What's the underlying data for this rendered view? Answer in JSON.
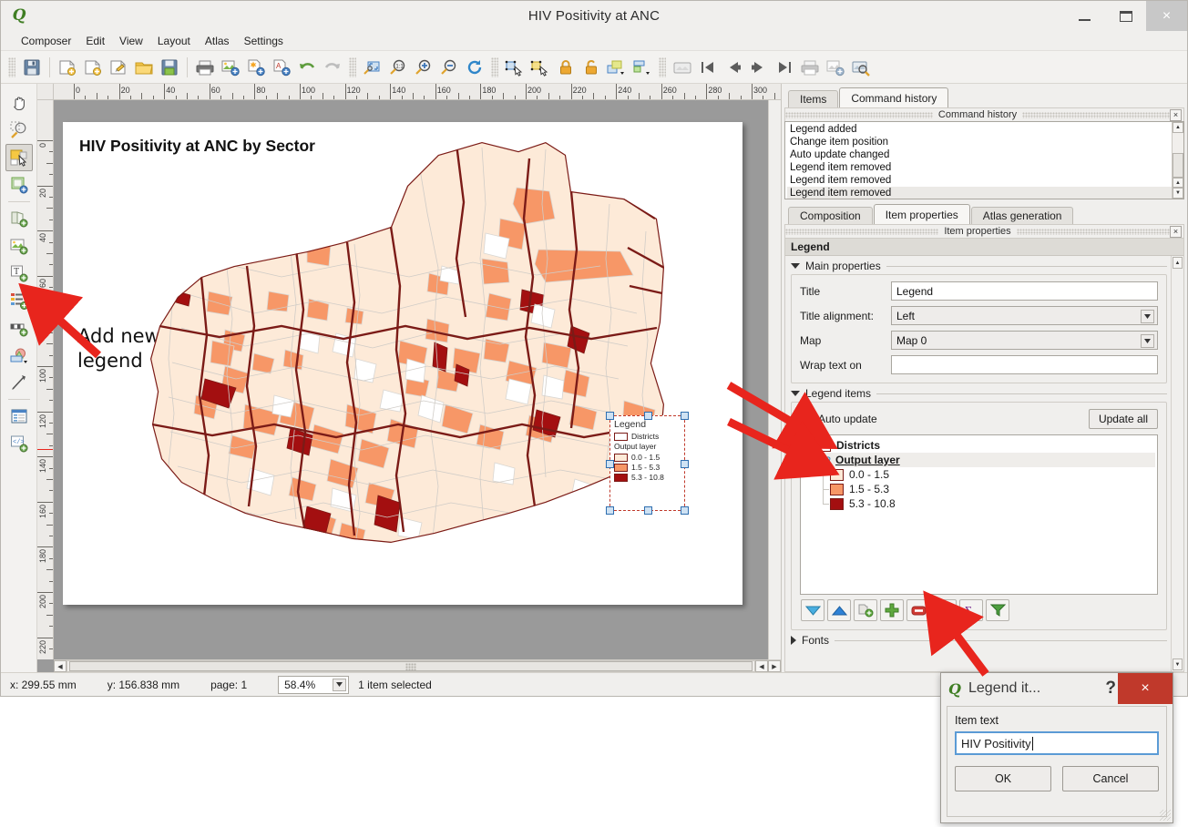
{
  "window": {
    "title": "HIV Positivity at ANC",
    "app_icon": "qgis-icon",
    "minimize_label": "minimize-icon",
    "maximize_label": "maximize-icon",
    "close_label": "×"
  },
  "menubar": {
    "items": [
      "Composer",
      "Edit",
      "View",
      "Layout",
      "Atlas",
      "Settings"
    ]
  },
  "toolbar": {
    "groups": [
      {
        "icons": [
          "save-icon"
        ]
      },
      {
        "icons": [
          "new-composition-icon",
          "duplicate-composition-icon",
          "composer-manager-icon",
          "open-template-icon",
          "save-template-icon"
        ]
      },
      {
        "icons": [
          "print-icon",
          "export-image-icon",
          "export-svg-icon",
          "export-pdf-icon",
          "undo-icon",
          "redo-icon"
        ]
      },
      {
        "icons": [
          "zoom-full-icon",
          "zoom-actual-icon",
          "zoom-in-icon",
          "zoom-out-icon",
          "refresh-icon"
        ]
      },
      {
        "icons": [
          "select-move-item-icon",
          "move-content-icon",
          "lock-items-icon",
          "unlock-items-icon",
          "raise-items-icon",
          "align-items-icon"
        ]
      },
      {
        "icons": [
          "atlas-settings-icon",
          "atlas-first-icon",
          "atlas-prev-icon",
          "atlas-next-icon",
          "atlas-last-icon",
          "atlas-print-icon",
          "atlas-export-image-icon",
          "atlas-preview-icon"
        ]
      }
    ]
  },
  "left_toolbar": {
    "items": [
      {
        "name": "pan-layout-tool",
        "icon": "hand-icon",
        "active": false
      },
      {
        "name": "zoom-tool",
        "icon": "magnifier-icon",
        "active": false
      },
      {
        "name": "select-move-item-tool",
        "icon": "select-arrow-icon",
        "active": true
      },
      {
        "name": "move-item-content-tool",
        "icon": "move-content-icon",
        "active": false
      },
      {
        "name": "add-new-map-tool",
        "icon": "add-map-icon",
        "active": false
      },
      {
        "name": "add-image-tool",
        "icon": "add-image-icon",
        "active": false
      },
      {
        "name": "add-label-tool",
        "icon": "add-label-icon",
        "active": false
      },
      {
        "name": "add-legend-tool",
        "icon": "add-legend-icon",
        "active": false
      },
      {
        "name": "add-scalebar-tool",
        "icon": "add-scalebar-icon",
        "active": false
      },
      {
        "name": "add-shape-tool",
        "icon": "add-shape-icon",
        "active": false
      },
      {
        "name": "add-arrow-tool",
        "icon": "add-arrow-icon",
        "active": false
      },
      {
        "name": "add-attribute-table-tool",
        "icon": "add-table-icon",
        "active": false
      },
      {
        "name": "add-html-frame-tool",
        "icon": "add-html-icon",
        "active": false
      }
    ]
  },
  "rulers": {
    "horizontal_labels": [
      "0",
      "20",
      "40",
      "60",
      "80",
      "100",
      "120",
      "140",
      "160",
      "180",
      "200",
      "220",
      "240",
      "260",
      "280",
      "300"
    ],
    "vertical_labels": [
      "0",
      "20",
      "40",
      "60",
      "80",
      "100",
      "120",
      "140",
      "160",
      "180",
      "200",
      "220"
    ],
    "unit": "mm"
  },
  "composition": {
    "map_title": "HIV Positivity at ANC by Sector",
    "annotation_line1": "Add new",
    "annotation_line2": "legend",
    "legend_item": {
      "title": "Legend",
      "districts_label": "Districts",
      "output_layer_label": "Output layer",
      "classes": [
        {
          "label": "0.0 - 1.5",
          "color": "#fdead8"
        },
        {
          "label": "1.5 - 5.3",
          "color": "#f79767"
        },
        {
          "label": "5.3 - 10.8",
          "color": "#a30f10"
        }
      ]
    }
  },
  "right_dock": {
    "top_tabs": [
      {
        "label": "Items",
        "selected": false
      },
      {
        "label": "Command history",
        "selected": true
      }
    ],
    "command_history": {
      "panel_title": "Command history",
      "close_label": "×",
      "entries": [
        {
          "text": "Legend added",
          "selected": false
        },
        {
          "text": "Change item position",
          "selected": false
        },
        {
          "text": "Auto update changed",
          "selected": false
        },
        {
          "text": "Legend item removed",
          "selected": false
        },
        {
          "text": "Legend item removed",
          "selected": false
        },
        {
          "text": "Legend item removed",
          "selected": true
        }
      ]
    },
    "bottom_tabs": [
      {
        "label": "Composition",
        "selected": false
      },
      {
        "label": "Item properties",
        "selected": true
      },
      {
        "label": "Atlas generation",
        "selected": false
      }
    ],
    "item_properties": {
      "panel_title": "Item properties",
      "close_label": "×",
      "header": "Legend",
      "main_properties": {
        "group_label": "Main properties",
        "title_label": "Title",
        "title_value": "Legend",
        "title_alignment_label": "Title alignment:",
        "title_alignment_value": "Left",
        "map_label": "Map",
        "map_value": "Map 0",
        "wrap_text_label": "Wrap text on",
        "wrap_text_value": ""
      },
      "legend_items": {
        "group_label": "Legend items",
        "auto_update_label": "Auto update",
        "auto_update_checked": false,
        "update_all_label": "Update all",
        "tree": [
          {
            "label": "Districts",
            "style": "bold",
            "swatch_fill": "#ffffff",
            "swatch_border": "#7b1b17",
            "indent": 1,
            "icon": "polygon-outline-icon"
          },
          {
            "label": "Output layer",
            "style": "bold-underline",
            "indent": 0,
            "icon": "layer-icon",
            "selected": true,
            "expander": "-"
          },
          {
            "label": "0.0 - 1.5",
            "style": "plain",
            "swatch_fill": "#fdead8",
            "swatch_border": "#7b1b17",
            "indent": 2
          },
          {
            "label": "1.5 - 5.3",
            "style": "plain",
            "swatch_fill": "#f79767",
            "swatch_border": "#7b1b17",
            "indent": 2
          },
          {
            "label": "5.3 - 10.8",
            "style": "plain",
            "swatch_fill": "#a30f10",
            "swatch_border": "#7b1b17",
            "indent": 2
          }
        ],
        "tools": [
          "move-down-icon",
          "move-up-icon",
          "add-group-icon",
          "add-item-icon",
          "remove-item-icon",
          "edit-item-text-icon",
          "sigma-expression-icon",
          "filter-legend-icon"
        ]
      },
      "fonts_group_label": "Fonts"
    }
  },
  "statusbar": {
    "x_label": "x: 299.55 mm",
    "y_label": "y: 156.838 mm",
    "page_label": "page: 1",
    "zoom_value": "58.4%",
    "selection_label": "1 item selected"
  },
  "dialog": {
    "title": "Legend it...",
    "help_label": "?",
    "close_label": "×",
    "field_label": "Item text",
    "field_value": "HIV Positivity",
    "ok_label": "OK",
    "cancel_label": "Cancel"
  },
  "colors": {
    "accent_red": "#e8251d",
    "class_low": "#fdead8",
    "class_mid": "#f79767",
    "class_high": "#a30f10",
    "district_border": "#7b1b17",
    "dialog_close": "#c0392b",
    "selection_blue": "#5b9bd5"
  }
}
